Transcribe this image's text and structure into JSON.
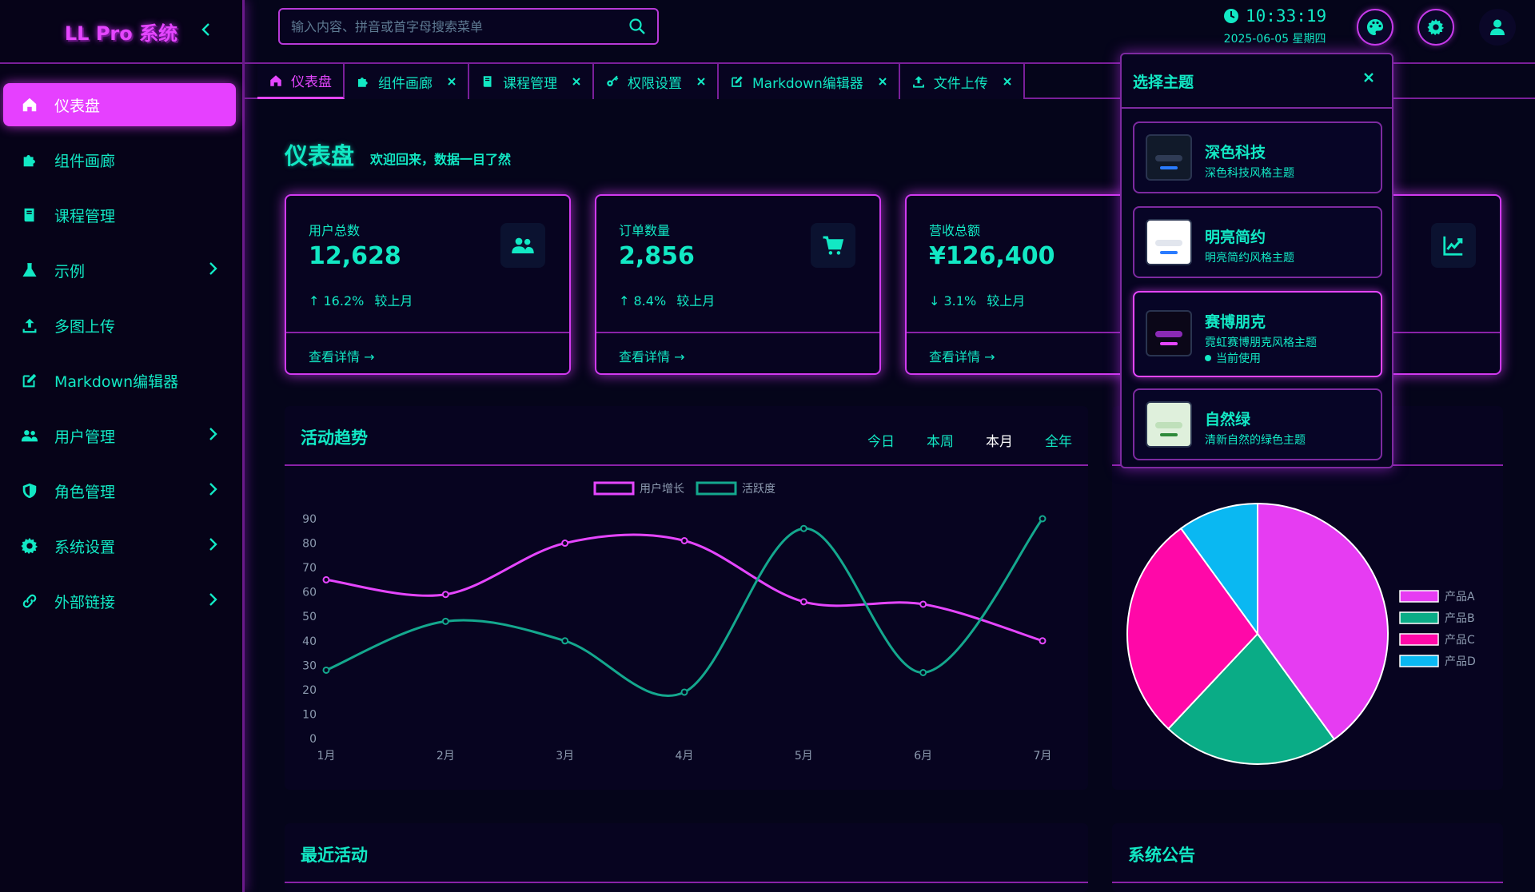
{
  "app": {
    "logo": "LL Pro 系统"
  },
  "sidebar": {
    "items": [
      {
        "label": "仪表盘",
        "icon": "home-icon",
        "active": true
      },
      {
        "label": "组件画廊",
        "icon": "puzzle-icon"
      },
      {
        "label": "课程管理",
        "icon": "book-icon"
      },
      {
        "label": "示例",
        "icon": "flask-icon",
        "has_children": true
      },
      {
        "label": "多图上传",
        "icon": "upload-icon"
      },
      {
        "label": "Markdown编辑器",
        "icon": "edit-icon"
      },
      {
        "label": "用户管理",
        "icon": "users-icon",
        "has_children": true
      },
      {
        "label": "角色管理",
        "icon": "shield-icon",
        "has_children": true
      },
      {
        "label": "系统设置",
        "icon": "gear-icon",
        "has_children": true
      },
      {
        "label": "外部链接",
        "icon": "link-icon",
        "has_children": true
      }
    ]
  },
  "header": {
    "search_placeholder": "输入内容、拼音或首字母搜索菜单",
    "time": "10:33:19",
    "date": "2025-06-05  星期四"
  },
  "tabs": [
    {
      "label": "仪表盘",
      "icon": "home-icon",
      "active": true
    },
    {
      "label": "组件画廊",
      "icon": "puzzle-icon"
    },
    {
      "label": "课程管理",
      "icon": "book-icon"
    },
    {
      "label": "权限设置",
      "icon": "key-icon"
    },
    {
      "label": "Markdown编辑器",
      "icon": "edit-icon"
    },
    {
      "label": "文件上传",
      "icon": "upload-icon"
    }
  ],
  "page": {
    "title": "仪表盘",
    "subtitle": "欢迎回来，数据一目了然"
  },
  "stats": [
    {
      "label": "用户总数",
      "value": "12,628",
      "change": "16.2%",
      "direction": "up",
      "compare": "较上月",
      "link": "查看详情",
      "icon": "users-icon"
    },
    {
      "label": "订单数量",
      "value": "2,856",
      "change": "8.4%",
      "direction": "up",
      "compare": "较上月",
      "link": "查看详情",
      "icon": "cart-icon"
    },
    {
      "label": "营收总额",
      "value": "¥126,400",
      "change": "3.1%",
      "direction": "down",
      "compare": "较上月",
      "link": "查看详情",
      "icon": "money-icon"
    },
    {
      "label": "",
      "value": "",
      "change": "",
      "direction": "",
      "compare": "",
      "link": "",
      "icon": "chart-line-icon"
    }
  ],
  "activity": {
    "title": "活动趋势",
    "ranges": [
      "今日",
      "本周",
      "本月",
      "全年"
    ],
    "selected_range": "本月"
  },
  "recent": {
    "title": "最近活动"
  },
  "notice": {
    "title": "系统公告"
  },
  "theme_popup": {
    "title": "选择主题",
    "current_label": "当前使用",
    "themes": [
      {
        "name": "深色科技",
        "desc": "深色科技风格主题",
        "current": false,
        "thumb_bg": "#111a2a",
        "thumb_bar": "#2f3b55",
        "thumb_accent": "#2a7bff"
      },
      {
        "name": "明亮简约",
        "desc": "明亮简约风格主题",
        "current": false,
        "thumb_bg": "#ffffff",
        "thumb_bar": "#e2e6ee",
        "thumb_accent": "#2a7bff"
      },
      {
        "name": "赛博朋克",
        "desc": "霓虹赛博朋克风格主题",
        "current": true,
        "thumb_bg": "#0b0718",
        "thumb_bar": "#8a2ab5",
        "thumb_accent": "#e546ff"
      },
      {
        "name": "自然绿",
        "desc": "清新自然的绿色主题",
        "current": false,
        "thumb_bg": "#dff0dc",
        "thumb_bar": "#bfe0ba",
        "thumb_accent": "#2e8a3a"
      }
    ]
  },
  "colors": {
    "accent": "#e546ff",
    "text": "#12e8c4",
    "background": "#05051a",
    "border": "#7a1f9a"
  },
  "chart_data": [
    {
      "type": "line",
      "categories": [
        "1月",
        "2月",
        "3月",
        "4月",
        "5月",
        "6月",
        "7月"
      ],
      "series": [
        {
          "name": "用户增长",
          "color": "#e546ff",
          "values": [
            65,
            59,
            80,
            81,
            56,
            55,
            40
          ]
        },
        {
          "name": "活跃度",
          "color": "#14a88e",
          "values": [
            28,
            48,
            40,
            19,
            86,
            27,
            90
          ]
        }
      ],
      "ylim": [
        0,
        90
      ],
      "yticks": [
        0,
        10,
        20,
        30,
        40,
        50,
        60,
        70,
        80,
        90
      ],
      "legend": "top-center",
      "smooth": true
    },
    {
      "type": "pie",
      "categories": [
        "产品A",
        "产品B",
        "产品C",
        "产品D"
      ],
      "values": [
        40,
        22,
        28,
        10
      ],
      "colors": [
        "#e63cf2",
        "#0aac86",
        "#ff08a8",
        "#0ab8f2"
      ],
      "legend": "right"
    }
  ]
}
